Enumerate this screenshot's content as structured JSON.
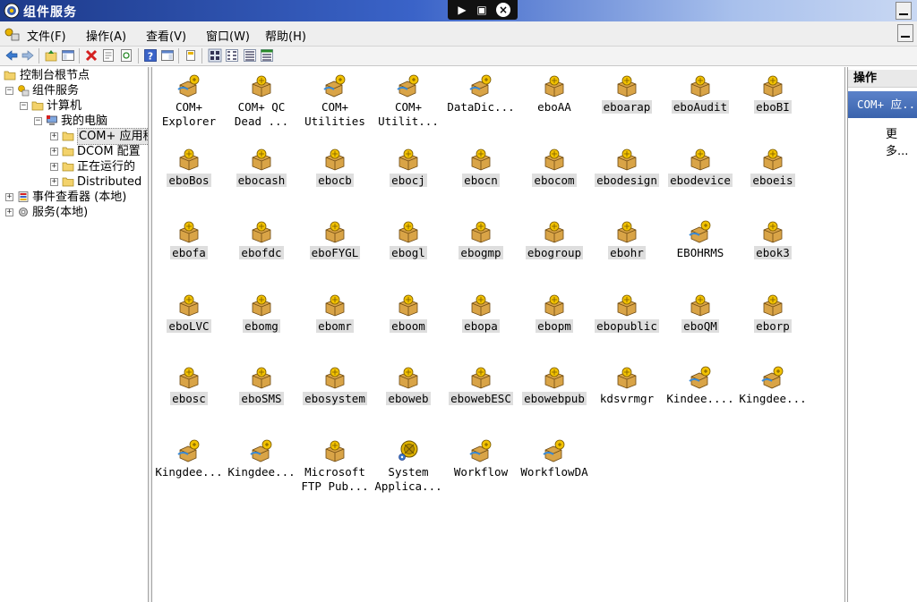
{
  "window": {
    "title": "组件服务"
  },
  "menu": [
    "文件(F)",
    "操作(A)",
    "查看(V)",
    "窗口(W)",
    "帮助(H)"
  ],
  "toolbar_icons": [
    "back-icon",
    "forward-icon",
    "up-folder-icon",
    "show-hide-tree-icon",
    "delete-icon",
    "properties-icon",
    "refresh-icon",
    "help-icon",
    "show-hide-action-pane-icon",
    "new-window-icon",
    "large-icons-view-icon",
    "small-icons-view-icon",
    "list-view-icon",
    "details-view-icon"
  ],
  "tree": [
    {
      "label": "控制台根节点",
      "expander": "",
      "icon": "folder-icon"
    },
    {
      "label": "组件服务",
      "expander": "−",
      "icon": "component-services-icon"
    },
    {
      "label": "计算机",
      "expander": "−",
      "icon": "folder-icon"
    },
    {
      "label": "我的电脑",
      "expander": "−",
      "icon": "computer-icon"
    },
    {
      "label": "COM+ 应用程",
      "expander": "+",
      "icon": "folder-icon"
    },
    {
      "label": "DCOM 配置",
      "expander": "+",
      "icon": "folder-icon"
    },
    {
      "label": "正在运行的",
      "expander": "+",
      "icon": "folder-icon"
    },
    {
      "label": "Distributed",
      "expander": "+",
      "icon": "folder-icon"
    },
    {
      "label": "事件查看器 (本地)",
      "expander": "+",
      "icon": "event-viewer-icon"
    },
    {
      "label": "服务(本地)",
      "expander": "+",
      "icon": "services-icon"
    }
  ],
  "applications": [
    {
      "label": "COM+\nExplorer",
      "icon": "com-app-globe-icon",
      "highlighted": false
    },
    {
      "label": "COM+ QC\nDead ...",
      "icon": "com-app-package-icon",
      "highlighted": false
    },
    {
      "label": "COM+\nUtilities",
      "icon": "com-app-globe-icon",
      "highlighted": false
    },
    {
      "label": "COM+\nUtilit...",
      "icon": "com-app-globe-icon",
      "highlighted": false
    },
    {
      "label": "DataDic...",
      "icon": "com-app-globe-icon",
      "highlighted": false
    },
    {
      "label": "eboAA",
      "icon": "com-app-package-icon",
      "highlighted": false
    },
    {
      "label": "eboarap",
      "icon": "com-app-package-icon",
      "highlighted": true
    },
    {
      "label": "eboAudit",
      "icon": "com-app-package-icon",
      "highlighted": true
    },
    {
      "label": "eboBI",
      "icon": "com-app-package-icon",
      "highlighted": true
    },
    {
      "label": "eboBos",
      "icon": "com-app-package-icon",
      "highlighted": true
    },
    {
      "label": "ebocash",
      "icon": "com-app-package-icon",
      "highlighted": true
    },
    {
      "label": "ebocb",
      "icon": "com-app-package-icon",
      "highlighted": true
    },
    {
      "label": "ebocj",
      "icon": "com-app-package-icon",
      "highlighted": true
    },
    {
      "label": "ebocn",
      "icon": "com-app-package-icon",
      "highlighted": true
    },
    {
      "label": "ebocom",
      "icon": "com-app-package-icon",
      "highlighted": true
    },
    {
      "label": "ebodesign",
      "icon": "com-app-package-icon",
      "highlighted": true
    },
    {
      "label": "ebodevice",
      "icon": "com-app-package-icon",
      "highlighted": true
    },
    {
      "label": "eboeis",
      "icon": "com-app-package-icon",
      "highlighted": true
    },
    {
      "label": "ebofa",
      "icon": "com-app-package-icon",
      "highlighted": true
    },
    {
      "label": "ebofdc",
      "icon": "com-app-package-icon",
      "highlighted": true
    },
    {
      "label": "eboFYGL",
      "icon": "com-app-package-icon",
      "highlighted": true
    },
    {
      "label": "ebogl",
      "icon": "com-app-package-icon",
      "highlighted": true
    },
    {
      "label": "ebogmp",
      "icon": "com-app-package-icon",
      "highlighted": true
    },
    {
      "label": "ebogroup",
      "icon": "com-app-package-icon",
      "highlighted": true
    },
    {
      "label": "ebohr",
      "icon": "com-app-package-icon",
      "highlighted": true
    },
    {
      "label": "EBOHRMS",
      "icon": "com-app-globe-icon",
      "highlighted": false
    },
    {
      "label": "ebok3",
      "icon": "com-app-package-icon",
      "highlighted": true
    },
    {
      "label": "eboLVC",
      "icon": "com-app-package-icon",
      "highlighted": true
    },
    {
      "label": "ebomg",
      "icon": "com-app-package-icon",
      "highlighted": true
    },
    {
      "label": "ebomr",
      "icon": "com-app-package-icon",
      "highlighted": true
    },
    {
      "label": "eboom",
      "icon": "com-app-package-icon",
      "highlighted": true
    },
    {
      "label": "ebopa",
      "icon": "com-app-package-icon",
      "highlighted": true
    },
    {
      "label": "ebopm",
      "icon": "com-app-package-icon",
      "highlighted": true
    },
    {
      "label": "ebopublic",
      "icon": "com-app-package-icon",
      "highlighted": true
    },
    {
      "label": "eboQM",
      "icon": "com-app-package-icon",
      "highlighted": true
    },
    {
      "label": "eborp",
      "icon": "com-app-package-icon",
      "highlighted": true
    },
    {
      "label": "ebosc",
      "icon": "com-app-package-icon",
      "highlighted": true
    },
    {
      "label": "eboSMS",
      "icon": "com-app-package-icon",
      "highlighted": true
    },
    {
      "label": "ebosystem",
      "icon": "com-app-package-icon",
      "highlighted": true
    },
    {
      "label": "eboweb",
      "icon": "com-app-package-icon",
      "highlighted": true
    },
    {
      "label": "ebowebESC",
      "icon": "com-app-package-icon",
      "highlighted": true
    },
    {
      "label": "ebowebpub",
      "icon": "com-app-package-icon",
      "highlighted": true
    },
    {
      "label": "kdsvrmgr",
      "icon": "com-app-package-icon",
      "highlighted": false
    },
    {
      "label": "Kindee....",
      "icon": "com-app-globe-icon",
      "highlighted": false
    },
    {
      "label": "Kingdee...",
      "icon": "com-app-globe-icon",
      "highlighted": false
    },
    {
      "label": "Kingdee...",
      "icon": "com-app-globe-icon",
      "highlighted": false
    },
    {
      "label": "Kingdee...",
      "icon": "com-app-globe-icon",
      "highlighted": false
    },
    {
      "label": "Microsoft\nFTP Pub...",
      "icon": "com-app-package-icon",
      "highlighted": false
    },
    {
      "label": "System\nApplica...",
      "icon": "system-application-icon",
      "highlighted": false
    },
    {
      "label": "Workflow",
      "icon": "com-app-globe-icon",
      "highlighted": false
    },
    {
      "label": "WorkflowDA",
      "icon": "com-app-globe-icon",
      "highlighted": false
    }
  ],
  "actions": {
    "header": "操作",
    "section": "COM+ 应...",
    "more": "更多..."
  }
}
